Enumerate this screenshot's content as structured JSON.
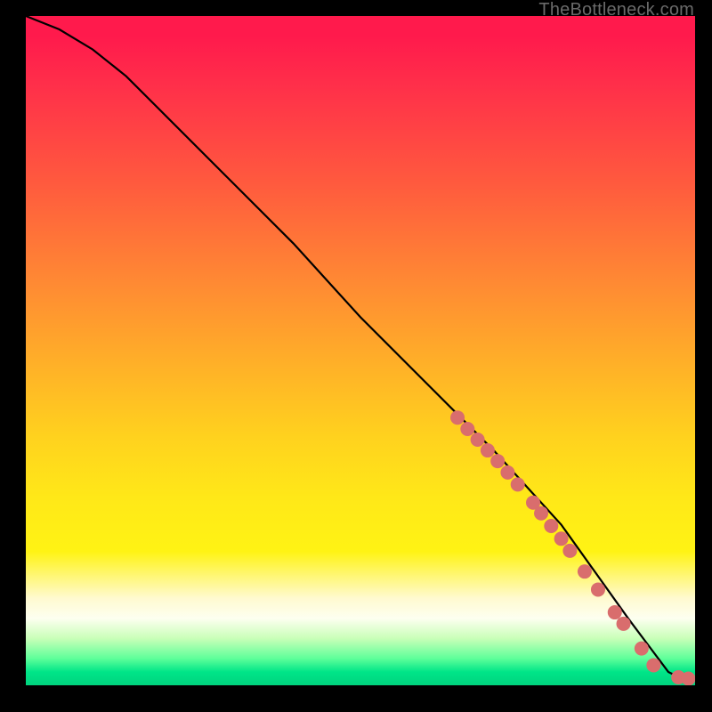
{
  "attribution": "TheBottleneck.com",
  "chart_data": {
    "type": "line",
    "title": "",
    "xlabel": "",
    "ylabel": "",
    "xlim": [
      0,
      100
    ],
    "ylim": [
      0,
      100
    ],
    "grid": false,
    "legend": false,
    "curve": {
      "name": "bottleneck-curve",
      "x": [
        0,
        5,
        10,
        15,
        20,
        30,
        40,
        50,
        60,
        70,
        80,
        85,
        90,
        93,
        96,
        98,
        100
      ],
      "y": [
        100,
        98,
        95,
        91,
        86,
        76,
        66,
        55,
        45,
        35,
        24,
        17,
        10,
        6,
        2,
        1,
        1
      ]
    },
    "markers": {
      "name": "sample-points",
      "color": "#d96d6d",
      "radius": 8,
      "points": [
        {
          "x": 64.5,
          "y": 40.0
        },
        {
          "x": 66.0,
          "y": 38.3
        },
        {
          "x": 67.5,
          "y": 36.7
        },
        {
          "x": 69.0,
          "y": 35.1
        },
        {
          "x": 70.5,
          "y": 33.5
        },
        {
          "x": 72.0,
          "y": 31.8
        },
        {
          "x": 73.5,
          "y": 30.0
        },
        {
          "x": 75.8,
          "y": 27.3
        },
        {
          "x": 77.0,
          "y": 25.7
        },
        {
          "x": 78.5,
          "y": 23.8
        },
        {
          "x": 80.0,
          "y": 21.9
        },
        {
          "x": 81.3,
          "y": 20.1
        },
        {
          "x": 83.5,
          "y": 17.0
        },
        {
          "x": 85.5,
          "y": 14.3
        },
        {
          "x": 88.0,
          "y": 10.9
        },
        {
          "x": 89.3,
          "y": 9.2
        },
        {
          "x": 92.0,
          "y": 5.5
        },
        {
          "x": 93.8,
          "y": 3.0
        },
        {
          "x": 97.5,
          "y": 1.2
        },
        {
          "x": 99.0,
          "y": 1.0
        }
      ]
    },
    "background_gradient": {
      "top_color": "#ff1a4c",
      "mid_color": "#fff314",
      "bottom_color": "#00d37e"
    }
  }
}
